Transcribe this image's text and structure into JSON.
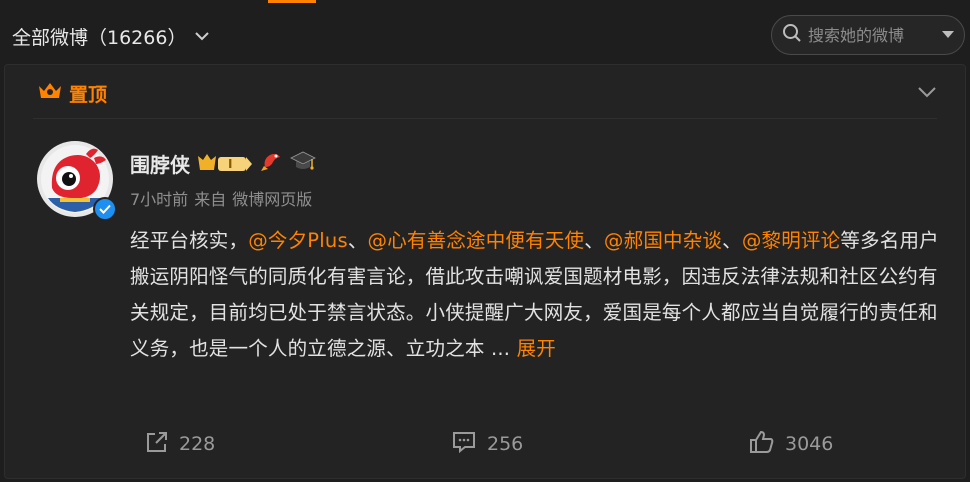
{
  "header": {
    "feed_title": "全部微博（16266）",
    "search_placeholder": "搜索她的微博"
  },
  "post": {
    "pinned_label": "置顶",
    "user_name": "围脖侠",
    "level_badge": "I",
    "time": "7小时前",
    "source_prefix": "来自",
    "source": "微博网页版",
    "text_parts": {
      "intro": "经平台核实，",
      "mention1": "@今夕Plus",
      "sep1": "、",
      "mention2": "@心有善念途中便有天使",
      "sep2": "、",
      "mention3": "@郝国中杂谈",
      "sep3": "、",
      "mention4": "@黎明评论",
      "body": "等多名用户搬运阴阳怪气的同质化有害言论，借此攻击嘲讽爱国题材电影，因违反法律法规和社区公约有关规定，目前均已处于禁言状态。小侠提醒广大网友，爱国是每个人都应当自觉履行的责任和义务，也是一个人的立德之源、立功之本 ...",
      "expand": "展开"
    },
    "actions": {
      "repost_count": "228",
      "comment_count": "256",
      "like_count": "3046"
    }
  },
  "colors": {
    "accent": "#ff8200",
    "background": "#1e1e1e",
    "card": "#232323",
    "verified": "#1d8ff0"
  },
  "icons": [
    "chevron-down-icon",
    "search-icon",
    "dropdown-caret-icon",
    "crown-icon",
    "level-badge-icon",
    "koi-icon",
    "graduation-cap-icon",
    "verified-icon",
    "repost-icon",
    "comment-icon",
    "like-icon"
  ]
}
